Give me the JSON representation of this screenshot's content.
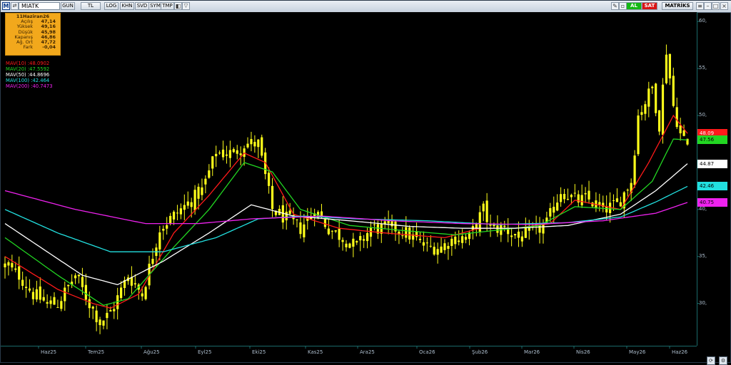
{
  "toolbar": {
    "symbol": "MIATK",
    "buttons": [
      "GUN",
      "TL",
      "LOG",
      "KHN",
      "SVD",
      "SYM",
      "TMP"
    ],
    "al_label": "AL",
    "sat_label": "SAT",
    "matriks_label": "MATRİKS",
    "chevron": "▽"
  },
  "info": {
    "date": "11Haziran26",
    "rows": [
      {
        "label": "Açılış",
        "value": "47,14"
      },
      {
        "label": "Yüksek",
        "value": "49,16"
      },
      {
        "label": "Düşük",
        "value": "45,98"
      },
      {
        "label": "Kapanış",
        "value": "46,86"
      },
      {
        "label": "Ağ. Ort",
        "value": "47,72"
      },
      {
        "label": "Fark",
        "value": "-0,04"
      }
    ]
  },
  "legend": [
    {
      "label": "MAV(10)",
      "value": ":48.0902",
      "color": "#ff1a1a"
    },
    {
      "label": "MAV(20)",
      "value": ":47.5592",
      "color": "#22d622"
    },
    {
      "label": "MAV(50)",
      "value": ":44.8696",
      "color": "#ffffff"
    },
    {
      "label": "MAV(100)",
      "value": ":42.464",
      "color": "#22e0e0"
    },
    {
      "label": "MAV(200)",
      "value": ":40.7473",
      "color": "#ee22ee"
    }
  ],
  "price_labels": [
    {
      "text": "48.09",
      "value": 48.09,
      "bg": "#ff1a1a",
      "fg": "#ffffff"
    },
    {
      "text": "47.56",
      "value": 47.4,
      "bg": "#22d622",
      "fg": "#000000"
    },
    {
      "text": "44.87",
      "value": 44.87,
      "bg": "#ffffff",
      "fg": "#000000"
    },
    {
      "text": "42.46",
      "value": 42.46,
      "bg": "#22e0e0",
      "fg": "#000000"
    },
    {
      "text": "40.75",
      "value": 40.75,
      "bg": "#ee22ee",
      "fg": "#000000"
    }
  ],
  "colors": {
    "candle": "#ffff1a",
    "axis": "#1a6a6a"
  },
  "chart_data": {
    "type": "line",
    "ylim": [
      25.5,
      61.0
    ],
    "y_ticks": [
      {
        "label": "60,",
        "value": 60
      },
      {
        "label": "55,",
        "value": 55
      },
      {
        "label": "50,",
        "value": 50
      },
      {
        "label": "45,",
        "value": 45
      },
      {
        "label": "40,",
        "value": 40
      },
      {
        "label": "35,",
        "value": 35
      },
      {
        "label": "30,",
        "value": 30
      }
    ],
    "x_ticks": [
      "Haz25",
      "Tem25",
      "Ağu25",
      "Eyl25",
      "Eki25",
      "Kas25",
      "Ara25",
      "Oca26",
      "Şub26",
      "Mar26",
      "Nis26",
      "May26",
      "Haz26"
    ],
    "close_anchors": [
      [
        0,
        34
      ],
      [
        4,
        33
      ],
      [
        8,
        31
      ],
      [
        12,
        30
      ],
      [
        15,
        30
      ],
      [
        20,
        33
      ],
      [
        24,
        30
      ],
      [
        27,
        28
      ],
      [
        30,
        29
      ],
      [
        35,
        33
      ],
      [
        39,
        31
      ],
      [
        44,
        38
      ],
      [
        50,
        40
      ],
      [
        56,
        42
      ],
      [
        60,
        46
      ],
      [
        65,
        46
      ],
      [
        68,
        47
      ],
      [
        72,
        47
      ],
      [
        76,
        40
      ],
      [
        80,
        39
      ],
      [
        84,
        38
      ],
      [
        88,
        40
      ],
      [
        92,
        38
      ],
      [
        96,
        37
      ],
      [
        100,
        36
      ],
      [
        104,
        38
      ],
      [
        108,
        38
      ],
      [
        112,
        38
      ],
      [
        116,
        37
      ],
      [
        120,
        36
      ],
      [
        124,
        36
      ],
      [
        128,
        37
      ],
      [
        132,
        37
      ],
      [
        136,
        40
      ],
      [
        138,
        38
      ],
      [
        142,
        38
      ],
      [
        146,
        37
      ],
      [
        150,
        37.5
      ],
      [
        154,
        38.5
      ],
      [
        158,
        42
      ],
      [
        162,
        41
      ],
      [
        166,
        41
      ],
      [
        170,
        40
      ],
      [
        174,
        40.5
      ],
      [
        178,
        43
      ],
      [
        180,
        50
      ],
      [
        184,
        53
      ],
      [
        186,
        49
      ],
      [
        188,
        57
      ],
      [
        190,
        51
      ],
      [
        192,
        48
      ],
      [
        194,
        46.86
      ]
    ],
    "series": [
      {
        "name": "MAV(10)",
        "color": "#ff1a1a",
        "points": [
          [
            0,
            35
          ],
          [
            15,
            31.5
          ],
          [
            25,
            30
          ],
          [
            30,
            29.5
          ],
          [
            38,
            31
          ],
          [
            48,
            37.5
          ],
          [
            58,
            41.5
          ],
          [
            68,
            46
          ],
          [
            74,
            45
          ],
          [
            82,
            39.5
          ],
          [
            95,
            38
          ],
          [
            108,
            37.5
          ],
          [
            125,
            37
          ],
          [
            135,
            38
          ],
          [
            145,
            38
          ],
          [
            155,
            38.5
          ],
          [
            162,
            41
          ],
          [
            175,
            40
          ],
          [
            183,
            45
          ],
          [
            190,
            50
          ],
          [
            194,
            48.09
          ]
        ]
      },
      {
        "name": "MAV(20)",
        "color": "#22d622",
        "points": [
          [
            0,
            37
          ],
          [
            15,
            33
          ],
          [
            28,
            29.8
          ],
          [
            35,
            30.5
          ],
          [
            48,
            36
          ],
          [
            58,
            40
          ],
          [
            68,
            45
          ],
          [
            76,
            44
          ],
          [
            84,
            40
          ],
          [
            98,
            38.3
          ],
          [
            112,
            37.8
          ],
          [
            128,
            37.3
          ],
          [
            140,
            37.8
          ],
          [
            152,
            38.3
          ],
          [
            162,
            40.3
          ],
          [
            175,
            40
          ],
          [
            184,
            43
          ],
          [
            190,
            47.5
          ],
          [
            194,
            47.4
          ]
        ]
      },
      {
        "name": "MAV(50)",
        "color": "#ffffff",
        "points": [
          [
            0,
            38.5
          ],
          [
            10,
            36
          ],
          [
            22,
            33
          ],
          [
            32,
            32
          ],
          [
            45,
            34.5
          ],
          [
            58,
            37.5
          ],
          [
            70,
            40.5
          ],
          [
            82,
            39.3
          ],
          [
            98,
            38.8
          ],
          [
            115,
            38.2
          ],
          [
            130,
            38
          ],
          [
            145,
            38
          ],
          [
            160,
            38.3
          ],
          [
            175,
            39.5
          ],
          [
            185,
            42
          ],
          [
            194,
            44.87
          ]
        ]
      },
      {
        "name": "MAV(100)",
        "color": "#22e0e0",
        "points": [
          [
            0,
            40
          ],
          [
            15,
            37.5
          ],
          [
            30,
            35.5
          ],
          [
            45,
            35.5
          ],
          [
            60,
            37
          ],
          [
            72,
            39
          ],
          [
            85,
            39.3
          ],
          [
            100,
            39
          ],
          [
            120,
            38.8
          ],
          [
            140,
            38.4
          ],
          [
            160,
            38.6
          ],
          [
            175,
            39.2
          ],
          [
            185,
            40.8
          ],
          [
            194,
            42.46
          ]
        ]
      },
      {
        "name": "MAV(200)",
        "color": "#ee22ee",
        "points": [
          [
            0,
            42
          ],
          [
            20,
            40
          ],
          [
            40,
            38.5
          ],
          [
            55,
            38.5
          ],
          [
            70,
            39
          ],
          [
            90,
            39.3
          ],
          [
            110,
            38.8
          ],
          [
            130,
            38.5
          ],
          [
            150,
            38.4
          ],
          [
            170,
            38.8
          ],
          [
            185,
            39.6
          ],
          [
            194,
            40.75
          ]
        ]
      }
    ]
  }
}
